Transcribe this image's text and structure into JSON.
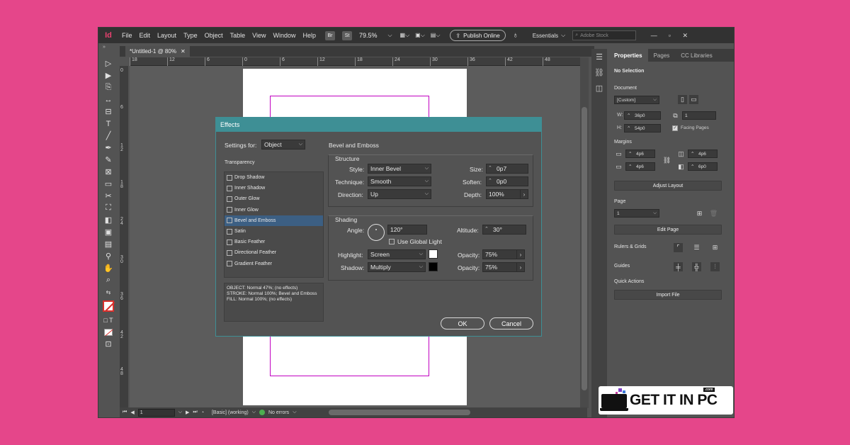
{
  "app": {
    "logo": "Id",
    "menu": [
      "File",
      "Edit",
      "Layout",
      "Type",
      "Object",
      "Table",
      "View",
      "Window",
      "Help"
    ],
    "bridge_badge": "Br",
    "stock_badge": "St",
    "zoom": "79.5%",
    "publish_label": "Publish Online",
    "workspace": "Essentials",
    "stock_placeholder": "Adobe Stock"
  },
  "document": {
    "tab_title": "*Untitled-1 @ 80%",
    "ruler_top": [
      "18",
      "12",
      "6",
      "0",
      "6",
      "12",
      "18",
      "24",
      "30",
      "36",
      "42",
      "48",
      "5"
    ],
    "ruler_left": [
      "0",
      "6",
      "1\n2",
      "1\n8",
      "2\n4",
      "3\n0",
      "3\n6",
      "4\n2",
      "4\n8"
    ]
  },
  "status": {
    "page": "1",
    "preflight_profile": "[Basic] (working)",
    "errors": "No errors"
  },
  "panel": {
    "tabs": [
      "Properties",
      "Pages",
      "CC Libraries"
    ],
    "selection": "No Selection",
    "document_label": "Document",
    "preset": "[Custom]",
    "width_label": "W:",
    "width": "36p0",
    "height_label": "H:",
    "height": "54p0",
    "pages_count": "1",
    "facing_pages": "Facing Pages",
    "margins_label": "Margins",
    "margin_top": "4p6",
    "margin_bottom": "4p6",
    "margin_inside": "4p6",
    "margin_outside": "6p0",
    "adjust_layout": "Adjust Layout",
    "page_label": "Page",
    "page_value": "1",
    "edit_page": "Edit Page",
    "rulers_grids": "Rulers & Grids",
    "guides": "Guides",
    "quick_actions": "Quick Actions",
    "import_file": "Import File"
  },
  "dialog": {
    "title": "Effects",
    "settings_for_label": "Settings for:",
    "settings_for_value": "Object",
    "section_title": "Bevel and Emboss",
    "transparency_label": "Transparency",
    "effects": [
      {
        "label": "Drop Shadow",
        "selected": false
      },
      {
        "label": "Inner Shadow",
        "selected": false
      },
      {
        "label": "Outer Glow",
        "selected": false
      },
      {
        "label": "Inner Glow",
        "selected": false
      },
      {
        "label": "Bevel and Emboss",
        "selected": true
      },
      {
        "label": "Satin",
        "selected": false
      },
      {
        "label": "Basic Feather",
        "selected": false
      },
      {
        "label": "Directional Feather",
        "selected": false
      },
      {
        "label": "Gradient Feather",
        "selected": false
      }
    ],
    "summary": "OBJECT: Normal 47%; (no effects)\nSTROKE: Normal 100%; Bevel and Emboss\nFILL: Normal 100%; (no effects)",
    "structure": {
      "label": "Structure",
      "style_label": "Style:",
      "style": "Inner Bevel",
      "technique_label": "Technique:",
      "technique": "Smooth",
      "direction_label": "Direction:",
      "direction": "Up",
      "size_label": "Size:",
      "size": "0p7",
      "soften_label": "Soften:",
      "soften": "0p0",
      "depth_label": "Depth:",
      "depth": "100%"
    },
    "shading": {
      "label": "Shading",
      "angle_label": "Angle:",
      "angle": "120°",
      "altitude_label": "Altitude:",
      "altitude": "30°",
      "global_light": "Use Global Light",
      "highlight_label": "Highlight:",
      "highlight": "Screen",
      "shadow_label": "Shadow:",
      "shadow": "Multiply",
      "opacity_label": "Opacity:",
      "highlight_opacity": "75%",
      "shadow_opacity": "75%",
      "highlight_color": "#ffffff",
      "shadow_color": "#000000"
    },
    "ok_label": "OK",
    "cancel_label": "Cancel"
  },
  "watermark": {
    "text": "GET IT IN PC",
    "suffix": ".com"
  }
}
